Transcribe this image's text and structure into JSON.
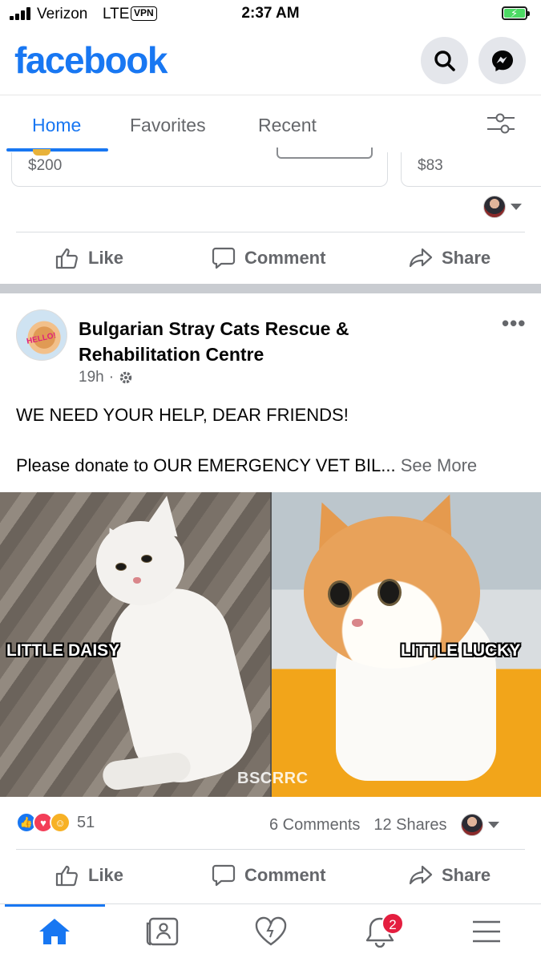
{
  "status_bar": {
    "carrier": "Verizon",
    "network": "LTE",
    "vpn": "VPN",
    "time": "2:37 AM"
  },
  "header": {
    "logo": "facebook",
    "icons": [
      "search-icon",
      "messenger-icon"
    ]
  },
  "tabs": [
    {
      "label": "Home",
      "active": true
    },
    {
      "label": "Favorites",
      "active": false
    },
    {
      "label": "Recent",
      "active": false
    }
  ],
  "previous_post": {
    "prices": [
      "$200",
      "$83"
    ]
  },
  "actions": {
    "like": "Like",
    "comment": "Comment",
    "share": "Share"
  },
  "post": {
    "author": "Bulgarian Stray Cats Rescue & Rehabilitation Centre",
    "avatar_text": "HELLO!",
    "time": "19h",
    "text_line1": "WE NEED YOUR HELP, DEAR FRIENDS!",
    "text_line2": "Please donate to OUR EMERGENCY VET BIL...",
    "see_more": "See More",
    "photo_labels": {
      "left": "LITTLE DAISY",
      "right": "LITTLE LUCKY",
      "watermark": "BSCRRC"
    },
    "reaction_count": "51",
    "comments": "6 Comments",
    "shares": "12 Shares"
  },
  "bottom_nav": {
    "items": [
      "home-icon",
      "news-icon",
      "dating-icon",
      "notifications-icon",
      "menu-icon"
    ],
    "notification_badge": "2"
  },
  "colors": {
    "brand": "#1877f2",
    "secondary_text": "#65676b",
    "badge": "#e41e3f"
  }
}
